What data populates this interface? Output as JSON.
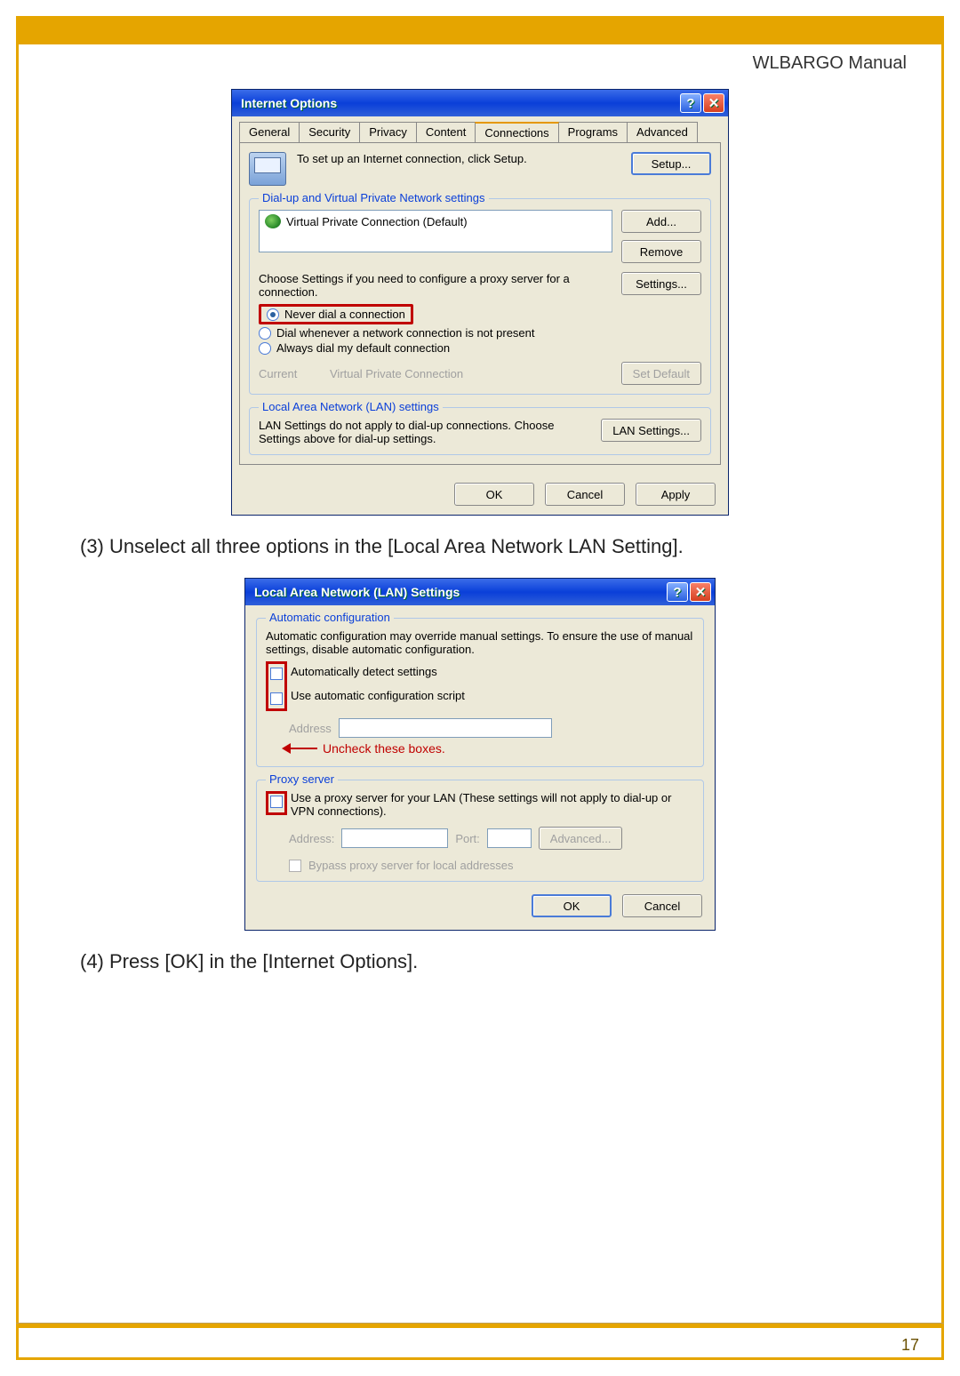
{
  "doc": {
    "title": "WLBARGO Manual",
    "page_number": "17",
    "instruction3": "(3) Unselect all three options in the  [Local Area Network LAN Setting].",
    "instruction4": "(4) Press [OK] in the [Internet Options]."
  },
  "internet_options": {
    "title": "Internet Options",
    "tabs": [
      "General",
      "Security",
      "Privacy",
      "Content",
      "Connections",
      "Programs",
      "Advanced"
    ],
    "active_tab": "Connections",
    "setup_text": "To set up an Internet connection, click Setup.",
    "setup_button": "Setup...",
    "group1_title": "Dial-up and Virtual Private Network settings",
    "vpn_item": "Virtual Private Connection (Default)",
    "add_button": "Add...",
    "remove_button": "Remove",
    "choose_text": "Choose Settings if you need to configure a proxy server for a connection.",
    "settings_button": "Settings...",
    "radio_never": "Never dial a connection",
    "radio_dial_when": "Dial whenever a network connection is not present",
    "radio_always": "Always dial my default connection",
    "current_label": "Current",
    "current_value": "Virtual Private Connection",
    "set_default": "Set Default",
    "group2_title": "Local Area Network (LAN) settings",
    "lan_text": "LAN Settings do not apply to dial-up connections. Choose Settings above for dial-up settings.",
    "lan_button": "LAN Settings...",
    "ok": "OK",
    "cancel": "Cancel",
    "apply": "Apply"
  },
  "lan_settings": {
    "title": "Local Area Network (LAN) Settings",
    "group1_title": "Automatic configuration",
    "auto_text": "Automatic configuration may override manual settings.  To ensure the use of manual settings, disable automatic configuration.",
    "cb1": "Automatically detect settings",
    "cb2": "Use automatic configuration script",
    "address_label": "Address",
    "annotation": "Uncheck these boxes.",
    "group2_title": "Proxy server",
    "proxy_text": "Use a proxy server for your LAN (These settings will not apply to dial-up or VPN connections).",
    "addr2": "Address:",
    "port": "Port:",
    "advanced": "Advanced...",
    "bypass": "Bypass proxy server for local addresses",
    "ok": "OK",
    "cancel": "Cancel"
  }
}
